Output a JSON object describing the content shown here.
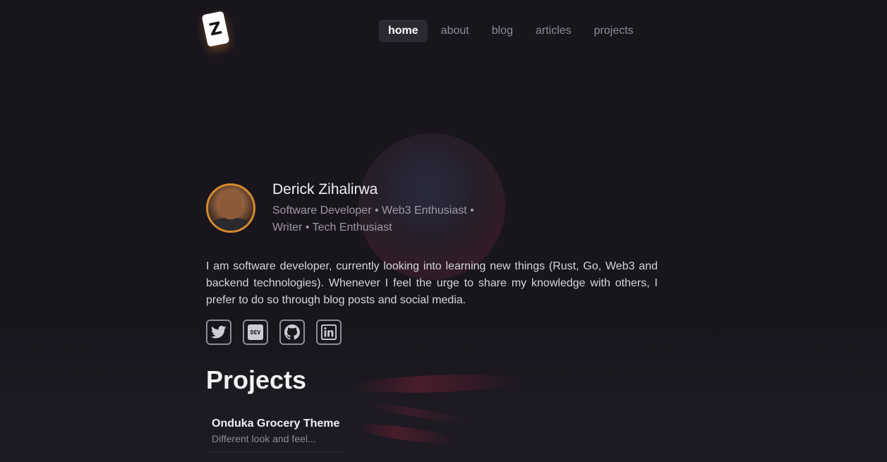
{
  "header": {
    "logo_letter": "Z",
    "nav": [
      {
        "label": "home",
        "active": true
      },
      {
        "label": "about",
        "active": false
      },
      {
        "label": "blog",
        "active": false
      },
      {
        "label": "articles",
        "active": false
      },
      {
        "label": "projects",
        "active": false
      }
    ]
  },
  "profile": {
    "name": "Derick Zihalirwa",
    "tagline": "Software Developer • Web3 Enthusiast • Writer • Tech Enthusiast",
    "bio": "I am software developer, currently looking into learning new things (Rust, Go, Web3 and backend technologies). Whenever I feel the urge to share my knowledge with others, I prefer to do so through blog posts and social media."
  },
  "socials": [
    {
      "icon": "twitter-icon"
    },
    {
      "icon": "dev-icon",
      "text": "DEV"
    },
    {
      "icon": "github-icon"
    },
    {
      "icon": "linkedin-icon"
    }
  ],
  "projects": {
    "title": "Projects",
    "items": [
      {
        "title": "Onduka Grocery Theme",
        "description": "Different look and feel..."
      }
    ]
  },
  "colors": {
    "background": "#18151d",
    "nav_active_bg": "#2c2933",
    "avatar_ring": "#d48a2c",
    "muted_text": "#8f8b96"
  }
}
